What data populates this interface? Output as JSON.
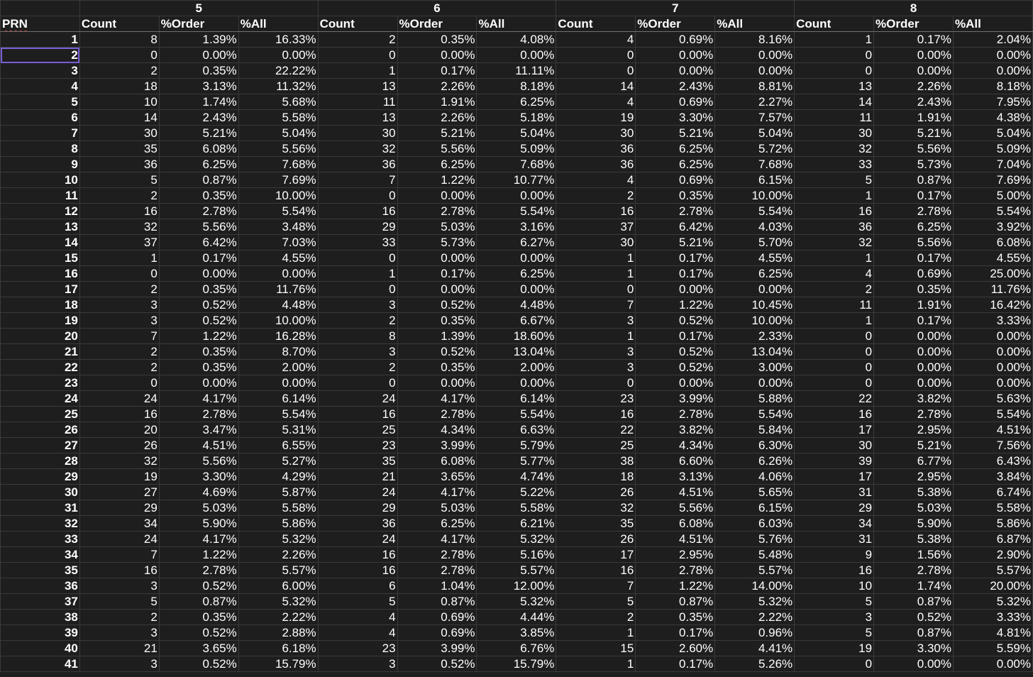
{
  "sheet": {
    "prn_header": "PRN",
    "sub_headers": [
      "Count",
      "%Order",
      "%All"
    ],
    "groups": [
      "5",
      "6",
      "7",
      "8"
    ],
    "selected_row": "2",
    "rows": [
      [
        "1",
        "8",
        "1.39%",
        "16.33%",
        "2",
        "0.35%",
        "4.08%",
        "4",
        "0.69%",
        "8.16%",
        "1",
        "0.17%",
        "2.04%"
      ],
      [
        "2",
        "0",
        "0.00%",
        "0.00%",
        "0",
        "0.00%",
        "0.00%",
        "0",
        "0.00%",
        "0.00%",
        "0",
        "0.00%",
        "0.00%"
      ],
      [
        "3",
        "2",
        "0.35%",
        "22.22%",
        "1",
        "0.17%",
        "11.11%",
        "0",
        "0.00%",
        "0.00%",
        "0",
        "0.00%",
        "0.00%"
      ],
      [
        "4",
        "18",
        "3.13%",
        "11.32%",
        "13",
        "2.26%",
        "8.18%",
        "14",
        "2.43%",
        "8.81%",
        "13",
        "2.26%",
        "8.18%"
      ],
      [
        "5",
        "10",
        "1.74%",
        "5.68%",
        "11",
        "1.91%",
        "6.25%",
        "4",
        "0.69%",
        "2.27%",
        "14",
        "2.43%",
        "7.95%"
      ],
      [
        "6",
        "14",
        "2.43%",
        "5.58%",
        "13",
        "2.26%",
        "5.18%",
        "19",
        "3.30%",
        "7.57%",
        "11",
        "1.91%",
        "4.38%"
      ],
      [
        "7",
        "30",
        "5.21%",
        "5.04%",
        "30",
        "5.21%",
        "5.04%",
        "30",
        "5.21%",
        "5.04%",
        "30",
        "5.21%",
        "5.04%"
      ],
      [
        "8",
        "35",
        "6.08%",
        "5.56%",
        "32",
        "5.56%",
        "5.09%",
        "36",
        "6.25%",
        "5.72%",
        "32",
        "5.56%",
        "5.09%"
      ],
      [
        "9",
        "36",
        "6.25%",
        "7.68%",
        "36",
        "6.25%",
        "7.68%",
        "36",
        "6.25%",
        "7.68%",
        "33",
        "5.73%",
        "7.04%"
      ],
      [
        "10",
        "5",
        "0.87%",
        "7.69%",
        "7",
        "1.22%",
        "10.77%",
        "4",
        "0.69%",
        "6.15%",
        "5",
        "0.87%",
        "7.69%"
      ],
      [
        "11",
        "2",
        "0.35%",
        "10.00%",
        "0",
        "0.00%",
        "0.00%",
        "2",
        "0.35%",
        "10.00%",
        "1",
        "0.17%",
        "5.00%"
      ],
      [
        "12",
        "16",
        "2.78%",
        "5.54%",
        "16",
        "2.78%",
        "5.54%",
        "16",
        "2.78%",
        "5.54%",
        "16",
        "2.78%",
        "5.54%"
      ],
      [
        "13",
        "32",
        "5.56%",
        "3.48%",
        "29",
        "5.03%",
        "3.16%",
        "37",
        "6.42%",
        "4.03%",
        "36",
        "6.25%",
        "3.92%"
      ],
      [
        "14",
        "37",
        "6.42%",
        "7.03%",
        "33",
        "5.73%",
        "6.27%",
        "30",
        "5.21%",
        "5.70%",
        "32",
        "5.56%",
        "6.08%"
      ],
      [
        "15",
        "1",
        "0.17%",
        "4.55%",
        "0",
        "0.00%",
        "0.00%",
        "1",
        "0.17%",
        "4.55%",
        "1",
        "0.17%",
        "4.55%"
      ],
      [
        "16",
        "0",
        "0.00%",
        "0.00%",
        "1",
        "0.17%",
        "6.25%",
        "1",
        "0.17%",
        "6.25%",
        "4",
        "0.69%",
        "25.00%"
      ],
      [
        "17",
        "2",
        "0.35%",
        "11.76%",
        "0",
        "0.00%",
        "0.00%",
        "0",
        "0.00%",
        "0.00%",
        "2",
        "0.35%",
        "11.76%"
      ],
      [
        "18",
        "3",
        "0.52%",
        "4.48%",
        "3",
        "0.52%",
        "4.48%",
        "7",
        "1.22%",
        "10.45%",
        "11",
        "1.91%",
        "16.42%"
      ],
      [
        "19",
        "3",
        "0.52%",
        "10.00%",
        "2",
        "0.35%",
        "6.67%",
        "3",
        "0.52%",
        "10.00%",
        "1",
        "0.17%",
        "3.33%"
      ],
      [
        "20",
        "7",
        "1.22%",
        "16.28%",
        "8",
        "1.39%",
        "18.60%",
        "1",
        "0.17%",
        "2.33%",
        "0",
        "0.00%",
        "0.00%"
      ],
      [
        "21",
        "2",
        "0.35%",
        "8.70%",
        "3",
        "0.52%",
        "13.04%",
        "3",
        "0.52%",
        "13.04%",
        "0",
        "0.00%",
        "0.00%"
      ],
      [
        "22",
        "2",
        "0.35%",
        "2.00%",
        "2",
        "0.35%",
        "2.00%",
        "3",
        "0.52%",
        "3.00%",
        "0",
        "0.00%",
        "0.00%"
      ],
      [
        "23",
        "0",
        "0.00%",
        "0.00%",
        "0",
        "0.00%",
        "0.00%",
        "0",
        "0.00%",
        "0.00%",
        "0",
        "0.00%",
        "0.00%"
      ],
      [
        "24",
        "24",
        "4.17%",
        "6.14%",
        "24",
        "4.17%",
        "6.14%",
        "23",
        "3.99%",
        "5.88%",
        "22",
        "3.82%",
        "5.63%"
      ],
      [
        "25",
        "16",
        "2.78%",
        "5.54%",
        "16",
        "2.78%",
        "5.54%",
        "16",
        "2.78%",
        "5.54%",
        "16",
        "2.78%",
        "5.54%"
      ],
      [
        "26",
        "20",
        "3.47%",
        "5.31%",
        "25",
        "4.34%",
        "6.63%",
        "22",
        "3.82%",
        "5.84%",
        "17",
        "2.95%",
        "4.51%"
      ],
      [
        "27",
        "26",
        "4.51%",
        "6.55%",
        "23",
        "3.99%",
        "5.79%",
        "25",
        "4.34%",
        "6.30%",
        "30",
        "5.21%",
        "7.56%"
      ],
      [
        "28",
        "32",
        "5.56%",
        "5.27%",
        "35",
        "6.08%",
        "5.77%",
        "38",
        "6.60%",
        "6.26%",
        "39",
        "6.77%",
        "6.43%"
      ],
      [
        "29",
        "19",
        "3.30%",
        "4.29%",
        "21",
        "3.65%",
        "4.74%",
        "18",
        "3.13%",
        "4.06%",
        "17",
        "2.95%",
        "3.84%"
      ],
      [
        "30",
        "27",
        "4.69%",
        "5.87%",
        "24",
        "4.17%",
        "5.22%",
        "26",
        "4.51%",
        "5.65%",
        "31",
        "5.38%",
        "6.74%"
      ],
      [
        "31",
        "29",
        "5.03%",
        "5.58%",
        "29",
        "5.03%",
        "5.58%",
        "32",
        "5.56%",
        "6.15%",
        "29",
        "5.03%",
        "5.58%"
      ],
      [
        "32",
        "34",
        "5.90%",
        "5.86%",
        "36",
        "6.25%",
        "6.21%",
        "35",
        "6.08%",
        "6.03%",
        "34",
        "5.90%",
        "5.86%"
      ],
      [
        "33",
        "24",
        "4.17%",
        "5.32%",
        "24",
        "4.17%",
        "5.32%",
        "26",
        "4.51%",
        "5.76%",
        "31",
        "5.38%",
        "6.87%"
      ],
      [
        "34",
        "7",
        "1.22%",
        "2.26%",
        "16",
        "2.78%",
        "5.16%",
        "17",
        "2.95%",
        "5.48%",
        "9",
        "1.56%",
        "2.90%"
      ],
      [
        "35",
        "16",
        "2.78%",
        "5.57%",
        "16",
        "2.78%",
        "5.57%",
        "16",
        "2.78%",
        "5.57%",
        "16",
        "2.78%",
        "5.57%"
      ],
      [
        "36",
        "3",
        "0.52%",
        "6.00%",
        "6",
        "1.04%",
        "12.00%",
        "7",
        "1.22%",
        "14.00%",
        "10",
        "1.74%",
        "20.00%"
      ],
      [
        "37",
        "5",
        "0.87%",
        "5.32%",
        "5",
        "0.87%",
        "5.32%",
        "5",
        "0.87%",
        "5.32%",
        "5",
        "0.87%",
        "5.32%"
      ],
      [
        "38",
        "2",
        "0.35%",
        "2.22%",
        "4",
        "0.69%",
        "4.44%",
        "2",
        "0.35%",
        "2.22%",
        "3",
        "0.52%",
        "3.33%"
      ],
      [
        "39",
        "3",
        "0.52%",
        "2.88%",
        "4",
        "0.69%",
        "3.85%",
        "1",
        "0.17%",
        "0.96%",
        "5",
        "0.87%",
        "4.81%"
      ],
      [
        "40",
        "21",
        "3.65%",
        "6.18%",
        "23",
        "3.99%",
        "6.76%",
        "15",
        "2.60%",
        "4.41%",
        "19",
        "3.30%",
        "5.59%"
      ],
      [
        "41",
        "3",
        "0.52%",
        "15.79%",
        "3",
        "0.52%",
        "15.79%",
        "1",
        "0.17%",
        "5.26%",
        "0",
        "0.00%",
        "0.00%"
      ]
    ]
  }
}
